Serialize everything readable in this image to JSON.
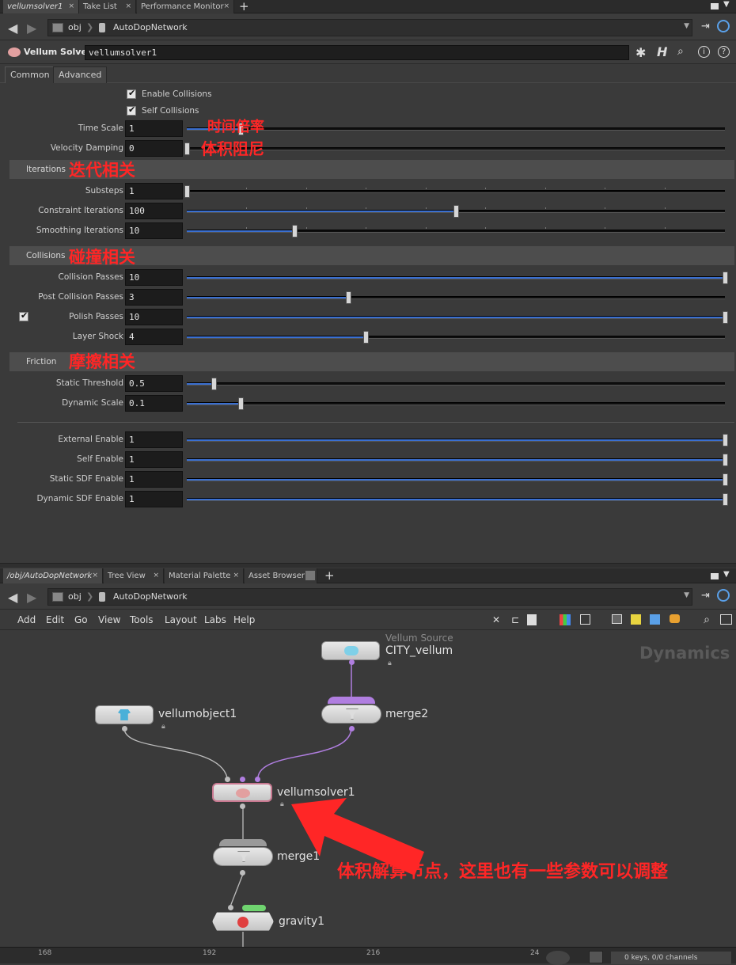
{
  "top_tabs": [
    {
      "label": "vellumsolver1"
    },
    {
      "label": "Take List"
    },
    {
      "label": "Performance Monitor"
    }
  ],
  "path": {
    "root": "obj",
    "network": "AutoDopNetwork"
  },
  "node_header": {
    "type_label": "Vellum Solver",
    "name": "vellumsolver1"
  },
  "param_tabs": [
    "Common",
    "Advanced"
  ],
  "toggles": [
    {
      "label": "Enable Collisions",
      "checked": true
    },
    {
      "label": "Self Collisions",
      "checked": true
    }
  ],
  "top_params": [
    {
      "label": "Time Scale",
      "value": "1",
      "fraction": 0.1
    },
    {
      "label": "Velocity Damping",
      "value": "0",
      "fraction": 0.0
    }
  ],
  "sections": {
    "iterations": "Iterations",
    "collisions": "Collisions",
    "friction": "Friction"
  },
  "iteration_params": [
    {
      "label": "Substeps",
      "value": "1",
      "fraction": 0.0
    },
    {
      "label": "Constraint Iterations",
      "value": "100",
      "fraction": 0.5
    },
    {
      "label": "Smoothing Iterations",
      "value": "10",
      "fraction": 0.2
    }
  ],
  "collision_params": [
    {
      "label": "Collision Passes",
      "value": "10",
      "fraction": 1.0
    },
    {
      "label": "Post Collision Passes",
      "value": "3",
      "fraction": 0.3
    },
    {
      "label": "Polish Passes",
      "value": "10",
      "fraction": 1.0,
      "toggle": true
    },
    {
      "label": "Layer Shock",
      "value": "4",
      "fraction": 0.333
    }
  ],
  "friction_params": [
    {
      "label": "Static Threshold",
      "value": "0.5",
      "fraction": 0.05
    },
    {
      "label": "Dynamic Scale",
      "value": "0.1",
      "fraction": 0.1
    }
  ],
  "enable_params": [
    {
      "label": "External Enable",
      "value": "1",
      "fraction": 1.0
    },
    {
      "label": "Self Enable",
      "value": "1",
      "fraction": 1.0
    },
    {
      "label": "Static SDF Enable",
      "value": "1",
      "fraction": 1.0
    },
    {
      "label": "Dynamic SDF Enable",
      "value": "1",
      "fraction": 1.0
    }
  ],
  "annotations": {
    "time_scale": "时间倍率",
    "velocity_damping": "体积阻尼",
    "iterations": "迭代相关",
    "collisions": "碰撞相关",
    "friction": "摩擦相关",
    "solver_node": "体积解算节点，这里也有一些参数可以调整"
  },
  "bottom_tabs": [
    {
      "label": "/obj/AutoDopNetwork"
    },
    {
      "label": "Tree View"
    },
    {
      "label": "Material Palette"
    },
    {
      "label": "Asset Browser"
    }
  ],
  "network_menu": [
    "Add",
    "Edit",
    "Go",
    "View",
    "Tools",
    "Layout",
    "Labs",
    "Help"
  ],
  "network": {
    "context_label": "Dynamics",
    "nodes": {
      "vellum_source_type": "Vellum Source",
      "vellum_source": "CITY_vellum",
      "merge2": "merge2",
      "vellumobject1": "vellumobject1",
      "vellumsolver1": "vellumsolver1",
      "merge1": "merge1",
      "gravity1": "gravity1"
    }
  },
  "timeline": {
    "ticks": [
      "168",
      "192",
      "216",
      "24"
    ],
    "status": "0 keys, 0/0 channels"
  },
  "colors": {
    "slider_fill": "#3a6fd0",
    "annotation": "#ff2626",
    "wire_purple": "#b07ee0"
  }
}
